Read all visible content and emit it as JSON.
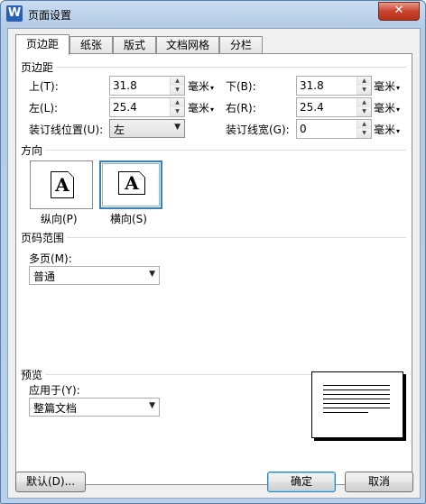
{
  "window": {
    "title": "页面设置",
    "app_icon_letter": "W",
    "close_glyph": "✕"
  },
  "tabs": [
    {
      "label": "页边距",
      "active": true
    },
    {
      "label": "纸张",
      "active": false
    },
    {
      "label": "版式",
      "active": false
    },
    {
      "label": "文档网格",
      "active": false
    },
    {
      "label": "分栏",
      "active": false
    }
  ],
  "margins": {
    "group_label": "页边距",
    "top": {
      "label": "上(T):",
      "value": "31.8",
      "unit": "毫米"
    },
    "bottom": {
      "label": "下(B):",
      "value": "31.8",
      "unit": "毫米"
    },
    "left": {
      "label": "左(L):",
      "value": "25.4",
      "unit": "毫米"
    },
    "right": {
      "label": "右(R):",
      "value": "25.4",
      "unit": "毫米"
    },
    "gutter_position": {
      "label": "装订线位置(U):",
      "value": "左"
    },
    "gutter_width": {
      "label": "装订线宽(G):",
      "value": "0",
      "unit": "毫米"
    }
  },
  "orientation": {
    "group_label": "方向",
    "portrait": {
      "label": "纵向(P)",
      "glyph": "A",
      "selected": false
    },
    "landscape": {
      "label": "横向(S)",
      "glyph": "A",
      "selected": true
    }
  },
  "pages": {
    "group_label": "页码范围",
    "multiple_label": "多页(M):",
    "multiple_value": "普通"
  },
  "preview": {
    "group_label": "预览",
    "apply_label": "应用于(Y):",
    "apply_value": "整篇文档"
  },
  "buttons": {
    "default": "默认(D)...",
    "ok": "确定",
    "cancel": "取消"
  },
  "icons": {
    "spin_up": "▲",
    "spin_down": "▼",
    "dropdown": "▼",
    "unit_caret": "▾"
  }
}
